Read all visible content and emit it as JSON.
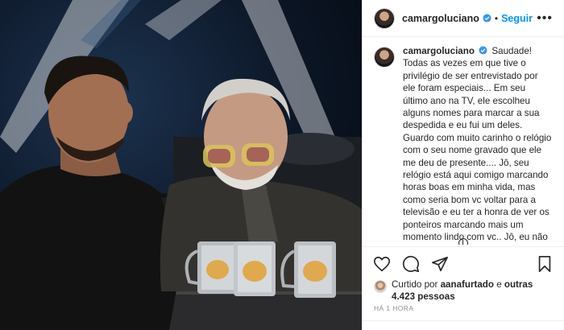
{
  "post": {
    "username": "camargoluciano",
    "follow_label": "Seguir",
    "header_separator": "•",
    "more_icon": "more-options-icon",
    "caption": {
      "username": "camargoluciano",
      "text": "Saudade! Todas as vezes em que tive o privilégio de ser entrevistado por ele foram especiais... Em seu último ano na TV, ele escolheu alguns nomes para marcar a sua despedida e eu fui um deles. Guardo com muito carinho o relógio com o seu nome gravado que ele me deu de presente.... Jô, seu relógio está aqui comigo marcando horas boas em minha vida, mas como seria bom vc voltar para a televisão e eu ter a honra de ver os ponteiros marcando mais um momento lindo com vc.. Jô, eu não ia pra cama sem vc.. Te amo!!"
    },
    "likes": {
      "prefix": "Curtido por",
      "liked_by": "aanafurtado",
      "conjunction": "e",
      "others": "outras 4.423 pessoas"
    },
    "time": "HÁ 1 HORA"
  },
  "colors": {
    "accent": "#0095f6",
    "text": "#262626",
    "muted": "#8e8e8e",
    "border": "#efefef"
  },
  "icons": [
    "verified-badge-icon",
    "heart-icon",
    "comment-icon",
    "share-icon",
    "bookmark-icon",
    "scroll-down-icon"
  ]
}
